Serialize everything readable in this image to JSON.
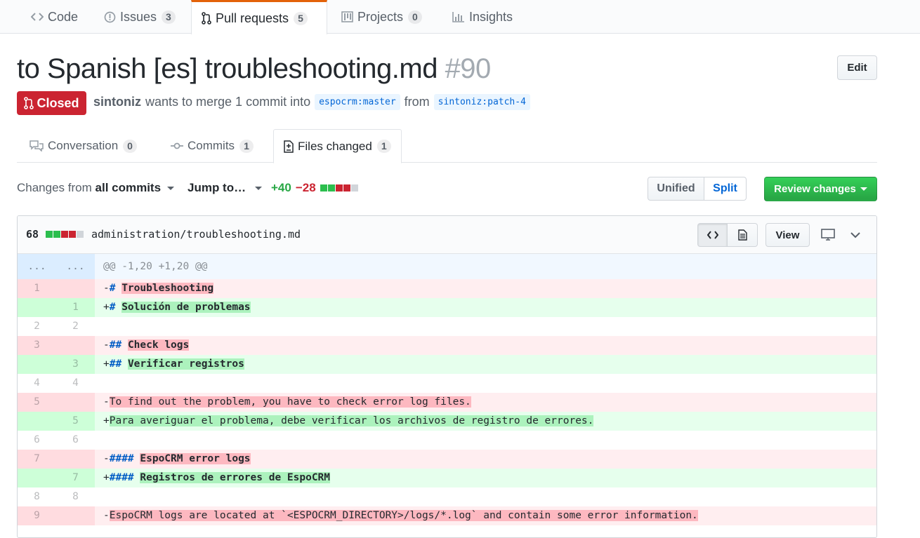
{
  "repo_nav": {
    "tabs": [
      {
        "label": "Code",
        "icon": "code-icon"
      },
      {
        "label": "Issues",
        "icon": "issue-opened-icon",
        "count": "3"
      },
      {
        "label": "Pull requests",
        "icon": "git-pull-request-icon",
        "count": "5",
        "selected": true
      },
      {
        "label": "Projects",
        "icon": "project-icon",
        "count": "0"
      },
      {
        "label": "Insights",
        "icon": "graph-icon"
      }
    ]
  },
  "pr": {
    "title": "to Spanish [es] troubleshooting.md",
    "number": "#90",
    "edit_label": "Edit",
    "state": "Closed",
    "author": "sintoniz",
    "meta_text": "wants to merge 1 commit into",
    "base_branch": "espocrm:master",
    "from_text": "from",
    "head_branch": "sintoniz:patch-4"
  },
  "pr_tabs": [
    {
      "label": "Conversation",
      "count": "0",
      "icon": "comment-discussion-icon"
    },
    {
      "label": "Commits",
      "count": "1",
      "icon": "git-commit-icon"
    },
    {
      "label": "Files changed",
      "count": "1",
      "icon": "file-diff-icon",
      "selected": true
    }
  ],
  "toolbar": {
    "changes_from": "Changes from",
    "all_commits": "all commits",
    "jump_to": "Jump to…",
    "additions": "+40",
    "deletions": "−28",
    "unified_label": "Unified",
    "split_label": "Split",
    "review_label": "Review changes"
  },
  "file": {
    "changes": "68",
    "path": "administration/troubleshooting.md",
    "view_label": "View",
    "hunk_header": "@@ -1,20 +1,20 @@",
    "hunk_ellipsis": "...",
    "lines": [
      {
        "type": "del",
        "old": "1",
        "new": "",
        "sign": "-",
        "hash": "#",
        "text": "Troubleshooting"
      },
      {
        "type": "add",
        "old": "",
        "new": "1",
        "sign": "+",
        "hash": "#",
        "text": "Solución de problemas"
      },
      {
        "type": "ctx",
        "old": "2",
        "new": "2",
        "sign": "",
        "hash": "",
        "text": ""
      },
      {
        "type": "del",
        "old": "3",
        "new": "",
        "sign": "-",
        "hash": "##",
        "text": "Check logs"
      },
      {
        "type": "add",
        "old": "",
        "new": "3",
        "sign": "+",
        "hash": "##",
        "text": "Verificar registros"
      },
      {
        "type": "ctx",
        "old": "4",
        "new": "4",
        "sign": "",
        "hash": "",
        "text": ""
      },
      {
        "type": "del",
        "old": "5",
        "new": "",
        "sign": "-",
        "hash": "",
        "text": "To find out the problem, you have to check error log files."
      },
      {
        "type": "add",
        "old": "",
        "new": "5",
        "sign": "+",
        "hash": "",
        "text": "Para averiguar el problema, debe verificar los archivos de registro de errores."
      },
      {
        "type": "ctx",
        "old": "6",
        "new": "6",
        "sign": "",
        "hash": "",
        "text": ""
      },
      {
        "type": "del",
        "old": "7",
        "new": "",
        "sign": "-",
        "hash": "####",
        "text": "EspoCRM error logs"
      },
      {
        "type": "add",
        "old": "",
        "new": "7",
        "sign": "+",
        "hash": "####",
        "text": "Registros de errores de EspoCRM"
      },
      {
        "type": "ctx",
        "old": "8",
        "new": "8",
        "sign": "",
        "hash": "",
        "text": ""
      },
      {
        "type": "del",
        "old": "9",
        "new": "",
        "sign": "-",
        "hash": "",
        "text": "EspoCRM logs are located at `<ESPOCRM_DIRECTORY>/logs/*.log` and contain some error information."
      }
    ]
  },
  "colors": {
    "closed_red": "#cb2431",
    "add_green": "#28a745",
    "link_blue": "#0366d6",
    "nav_accent_orange": "#e36209"
  }
}
